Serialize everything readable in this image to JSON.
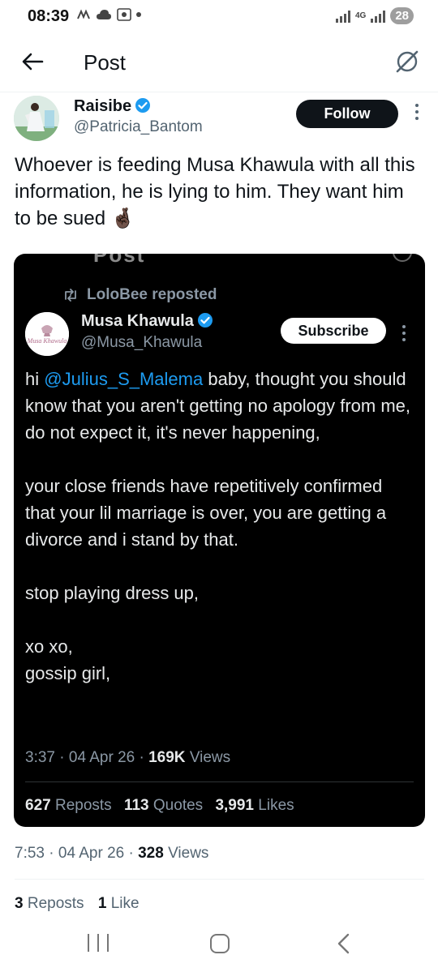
{
  "status_bar": {
    "time": "08:39",
    "network_label": "4G",
    "battery": "28"
  },
  "header": {
    "title": "Post"
  },
  "post": {
    "author_name": "Raisibe",
    "author_handle": "@Patricia_Bantom",
    "follow_label": "Follow",
    "text": "Whoever is feeding Musa Khawula with all this information, he is lying to him.  They want him to be sued 🤞🏿",
    "time": "7:53",
    "date": "04 Apr 26",
    "views_count": "328",
    "views_label": "Views",
    "reposts_count": "3",
    "reposts_label": "Reposts",
    "likes_count": "1",
    "likes_label": "Like"
  },
  "embed": {
    "cut_title": "Post",
    "repost_by": "LoloBee reposted",
    "author_name": "Musa Khawula",
    "author_handle": "@Musa_Khawula",
    "avatar_text": "Musa Khawula",
    "subscribe_label": "Subscribe",
    "body": {
      "p1_pre": "hi ",
      "p1_mention": "@Julius_S_Malema",
      "p1_post": " baby, thought you should know that you aren't getting no apology from me, do not expect it, it's never happening,",
      "p2": "your close friends have repetitively confirmed that your lil marriage is over, you are getting a divorce and i stand by that.",
      "p3": "stop playing dress up,",
      "p4": "xo xo,",
      "p5": "gossip girl,"
    },
    "time": "3:37",
    "date": "04 Apr 26",
    "views_count": "169K",
    "views_label": "Views",
    "reposts_count": "627",
    "reposts_label": "Reposts",
    "quotes_count": "113",
    "quotes_label": "Quotes",
    "likes_count": "3,991",
    "likes_label": "Likes"
  },
  "colors": {
    "link": "#1d9bf0",
    "verified": "#1d9bf0",
    "secondary_text": "#536471",
    "dark_bg": "#000000"
  }
}
